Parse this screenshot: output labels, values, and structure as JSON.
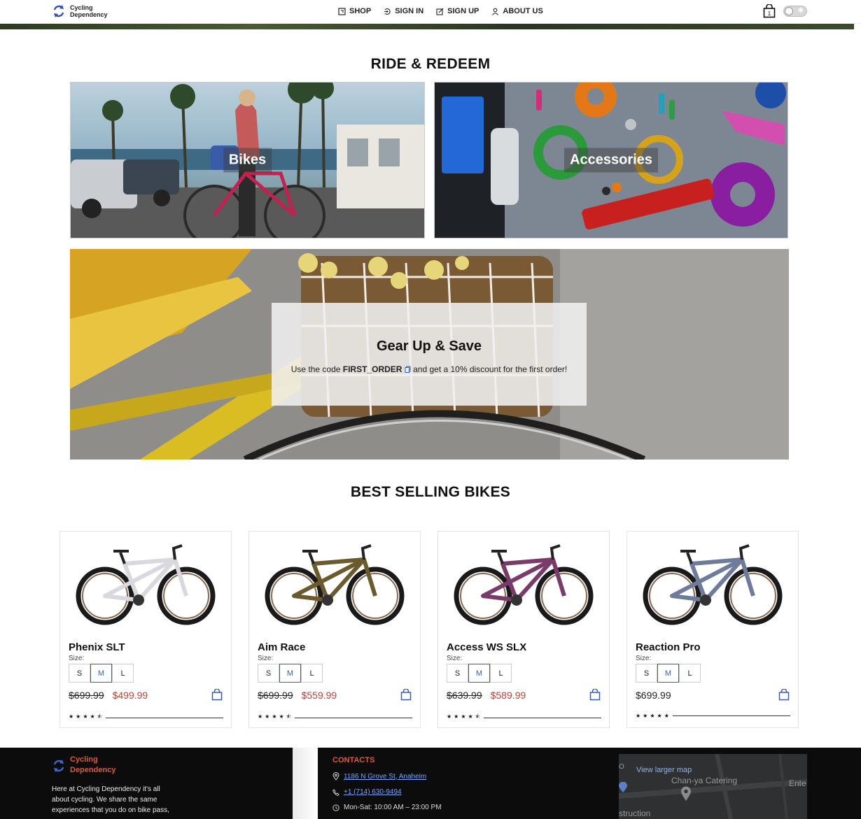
{
  "header": {
    "brand": {
      "line1": "Cycling",
      "line2": "Dependency"
    },
    "nav": [
      {
        "label": "SHOP",
        "icon": "shop-icon"
      },
      {
        "label": "SIGN IN",
        "icon": "sign-in-icon"
      },
      {
        "label": "SIGN UP",
        "icon": "sign-up-icon"
      },
      {
        "label": "ABOUT US",
        "icon": "about-icon"
      }
    ],
    "cart_count": "1"
  },
  "ride": {
    "title": "RIDE & REDEEM",
    "tiles": [
      {
        "label": "Bikes"
      },
      {
        "label": "Accessories"
      }
    ]
  },
  "promo": {
    "title": "Gear Up & Save",
    "text_before": "Use the code ",
    "code": "FIRST_ORDER",
    "text_after": " and get a 10% discount for the first order!"
  },
  "best": {
    "title": "BEST SELLING BIKES",
    "size_label": "Size:",
    "sizes": [
      "S",
      "M",
      "L"
    ],
    "products": [
      {
        "name": "Phenix SLT",
        "old_price": "$699.99",
        "price": "$499.99",
        "rating": 4.5,
        "frame_color": "#d8d8de"
      },
      {
        "name": "Aim Race",
        "old_price": "$699.99",
        "price": "$559.99",
        "rating": 4.5,
        "frame_color": "#6b5a2e"
      },
      {
        "name": "Access WS SLX",
        "old_price": "$639.99",
        "price": "$589.99",
        "rating": 4.5,
        "frame_color": "#7a3a6a"
      },
      {
        "name": "Reaction Pro",
        "old_price": "",
        "price": "$699.99",
        "rating": 5,
        "frame_color": "#6e7b9a"
      }
    ]
  },
  "footer": {
    "brand": {
      "line1": "Cycling",
      "line2": "Dependency"
    },
    "about": "Here at Cycling Dependency it's all about cycling. We share the same experiences that you do on bike pass,",
    "contacts_title": "CONTACTS",
    "address": "1186 N Grove St, Anaheim",
    "phone": "+1 (714) 630-9494",
    "hours": "Mon-Sat: 10:00 AM – 23:00 PM",
    "map": {
      "link": "View larger map",
      "place": "Chan-ya Catering",
      "label_right": "Ente",
      "label_bottom": "struction",
      "label_left": "O"
    }
  },
  "colors": {
    "accent": "#3b5bb5",
    "sale": "#b3473a",
    "brand_orange": "#e0583f"
  }
}
